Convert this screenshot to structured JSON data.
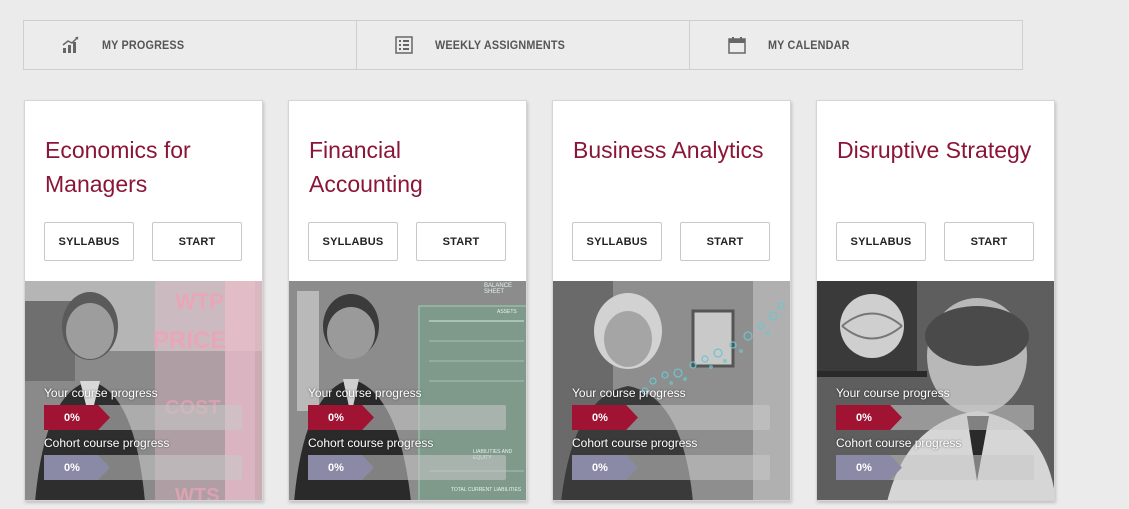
{
  "nav": [
    {
      "label": "MY PROGRESS",
      "icon": "bar-chart-icon"
    },
    {
      "label": "WEEKLY ASSIGNMENTS",
      "icon": "checklist-icon"
    },
    {
      "label": "MY CALENDAR",
      "icon": "calendar-icon"
    }
  ],
  "colors": {
    "accent": "#8b1538",
    "progress_you": "#a01333",
    "progress_cohort": "#8a8aa6"
  },
  "courses": [
    {
      "title": "Economics for Managers",
      "syllabus_label": "SYLLABUS",
      "start_label": "START",
      "your_progress_label": "Your course progress",
      "your_progress_value": "0%",
      "cohort_progress_label": "Cohort course progress",
      "cohort_progress_value": "0%",
      "image_texts": [
        "WTP",
        "PRICE",
        "COST",
        "WTS"
      ]
    },
    {
      "title": "Financial Accounting",
      "syllabus_label": "SYLLABUS",
      "start_label": "START",
      "your_progress_label": "Your course progress",
      "your_progress_value": "0%",
      "cohort_progress_label": "Cohort course progress",
      "cohort_progress_value": "0%",
      "image_texts": [
        "BALANCE SHEET",
        "ASSETS",
        "LIABILITIES AND EQUITY",
        "TOTAL CURRENT LIABILITIES"
      ]
    },
    {
      "title": "Business Analytics",
      "syllabus_label": "SYLLABUS",
      "start_label": "START",
      "your_progress_label": "Your course progress",
      "your_progress_value": "0%",
      "cohort_progress_label": "Cohort course progress",
      "cohort_progress_value": "0%"
    },
    {
      "title": "Disruptive Strategy",
      "syllabus_label": "SYLLABUS",
      "start_label": "START",
      "your_progress_label": "Your course progress",
      "your_progress_value": "0%",
      "cohort_progress_label": "Cohort course progress",
      "cohort_progress_value": "0%"
    }
  ]
}
